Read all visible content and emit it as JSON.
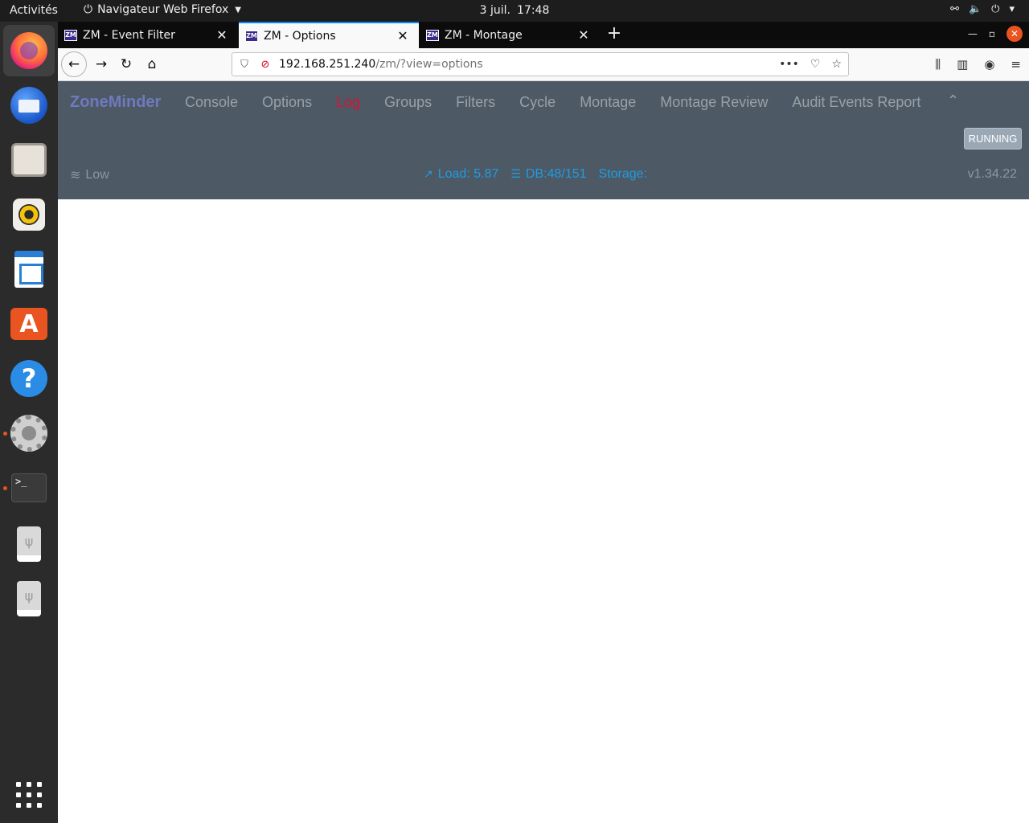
{
  "topbar": {
    "activities": "Activités",
    "app_name": "Navigateur Web Firefox",
    "date": "3 juil.",
    "time": "17:48"
  },
  "dock": {
    "items": [
      "firefox",
      "thunderbird",
      "files",
      "rhythmbox",
      "libreoffice-writer",
      "ubuntu-software",
      "help",
      "settings",
      "terminal",
      "usb-drive-1",
      "usb-drive-2"
    ],
    "terminal_glyph": ">_",
    "help_glyph": "?",
    "store_glyph": "A"
  },
  "browser": {
    "tabs": [
      {
        "favicon": "ZM",
        "title": "ZM - Event Filter",
        "selected": false
      },
      {
        "favicon": "ZM",
        "title": "ZM - Options",
        "selected": true
      },
      {
        "favicon": "ZM",
        "title": "ZM - Montage",
        "selected": false
      }
    ],
    "url_host": "192.168.251.240",
    "url_path": "/zm/?view=options"
  },
  "zoneminder": {
    "brand": "ZoneMinder",
    "menu": [
      "Console",
      "Options",
      "Log",
      "Groups",
      "Filters",
      "Cycle",
      "Montage",
      "Montage Review",
      "Audit Events Report"
    ],
    "active_menu": "Log",
    "status_button": "RUNNING",
    "bandwidth": "Low",
    "load": "Load: 5.87",
    "db": "DB:48/151",
    "storage": "Storage:",
    "version": "v1.34.22"
  },
  "colors": {
    "header_bg": "#4d5965",
    "brand": "#6f79bd",
    "accent_red": "#e0102f",
    "stats_blue": "#1e9de2",
    "ubuntu_orange": "#e95420"
  }
}
